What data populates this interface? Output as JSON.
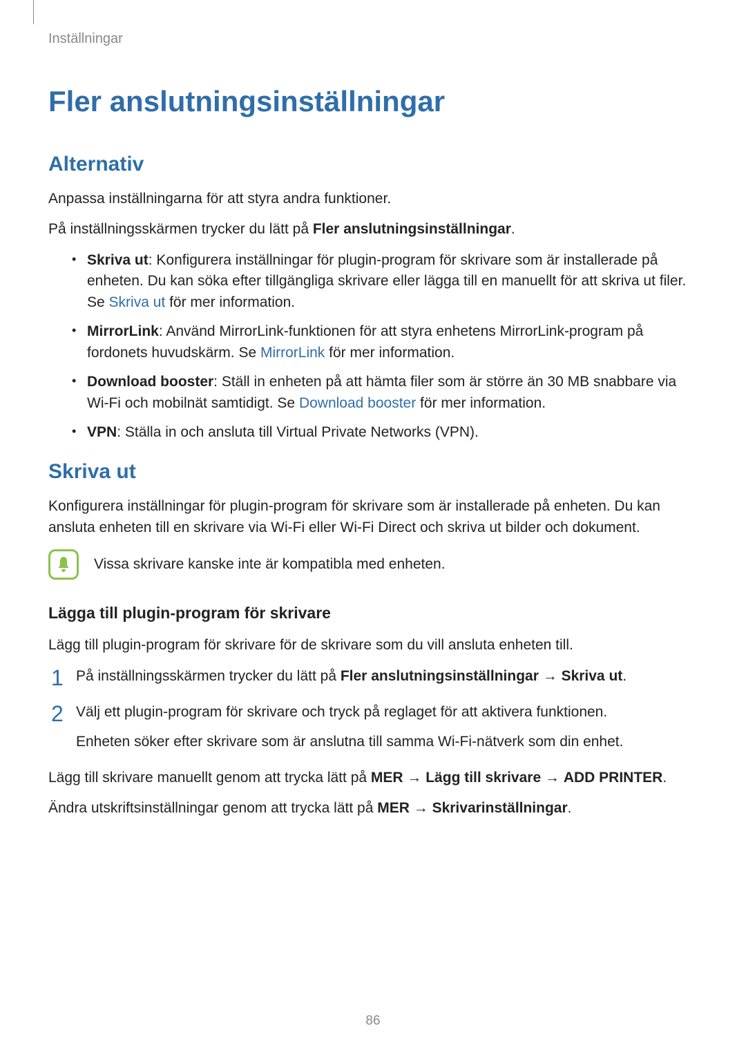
{
  "breadcrumb": "Inställningar",
  "h1": "Fler anslutningsinställningar",
  "section_alt": {
    "heading": "Alternativ",
    "p1": "Anpassa inställningarna för att styra andra funktioner.",
    "p2_a": "På inställningsskärmen trycker du lätt på ",
    "p2_b": "Fler anslutningsinställningar",
    "p2_c": ".",
    "bullets": {
      "b1_strong": "Skriva ut",
      "b1_a": ": Konfigurera inställningar för plugin-program för skrivare som är installerade på enheten. Du kan söka efter tillgängliga skrivare eller lägga till en manuellt för att skriva ut filer. Se ",
      "b1_link": "Skriva ut",
      "b1_b": " för mer information.",
      "b2_strong": "MirrorLink",
      "b2_a": ": Använd MirrorLink-funktionen för att styra enhetens MirrorLink-program på fordonets huvudskärm. Se ",
      "b2_link": "MirrorLink",
      "b2_b": " för mer information.",
      "b3_strong": "Download booster",
      "b3_a": ": Ställ in enheten på att hämta filer som är större än 30 MB snabbare via Wi-Fi och mobilnät samtidigt. Se ",
      "b3_link": "Download booster",
      "b3_b": " för mer information.",
      "b4_strong": "VPN",
      "b4_a": ": Ställa in och ansluta till Virtual Private Networks (VPN)."
    }
  },
  "section_skriva": {
    "heading": "Skriva ut",
    "p1": "Konfigurera inställningar för plugin-program för skrivare som är installerade på enheten. Du kan ansluta enheten till en skrivare via Wi-Fi eller Wi-Fi Direct och skriva ut bilder och dokument.",
    "note": "Vissa skrivare kanske inte är kompatibla med enheten.",
    "h3": "Lägga till plugin-program för skrivare",
    "p2": "Lägg till plugin-program för skrivare för de skrivare som du vill ansluta enheten till.",
    "steps": {
      "num1": "1",
      "s1_a": "På inställningsskärmen trycker du lätt på ",
      "s1_b": "Fler anslutningsinställningar",
      "s1_arrow1": " → ",
      "s1_c": "Skriva ut",
      "s1_d": ".",
      "num2": "2",
      "s2_a": "Välj ett plugin-program för skrivare och tryck på reglaget för att aktivera funktionen.",
      "s2_b": "Enheten söker efter skrivare som är anslutna till samma Wi-Fi-nätverk som din enhet."
    },
    "p3_a": "Lägg till skrivare manuellt genom att trycka lätt på ",
    "p3_b": "MER",
    "p3_arrow1": " → ",
    "p3_c": "Lägg till skrivare",
    "p3_arrow2": " → ",
    "p3_d": "ADD PRINTER",
    "p3_e": ".",
    "p4_a": "Ändra utskriftsinställningar genom att trycka lätt på ",
    "p4_b": "MER",
    "p4_arrow1": " → ",
    "p4_c": "Skrivarinställningar",
    "p4_d": "."
  },
  "page_number": "86"
}
